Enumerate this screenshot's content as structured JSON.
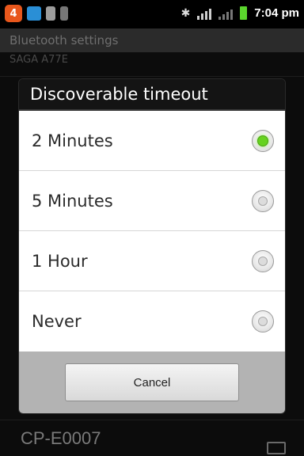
{
  "status_bar": {
    "notification_count": "4",
    "time": "7:04 pm",
    "battery_color": "#5bd62d"
  },
  "background_screen": {
    "title": "Bluetooth settings",
    "device_top": "SAGA A77E",
    "device_bottom": "CP-E0007"
  },
  "dialog": {
    "title": "Discoverable timeout",
    "options": [
      {
        "label": "2 Minutes",
        "selected": true
      },
      {
        "label": "5 Minutes",
        "selected": false
      },
      {
        "label": "1 Hour",
        "selected": false
      },
      {
        "label": "Never",
        "selected": false
      }
    ],
    "cancel_label": "Cancel",
    "accent_color": "#66d21f"
  }
}
